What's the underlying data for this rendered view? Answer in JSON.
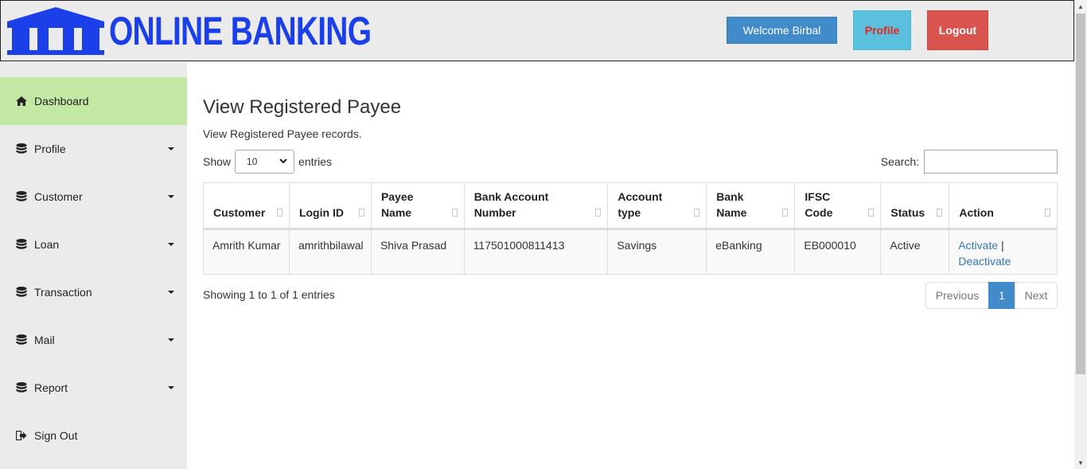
{
  "header": {
    "logo_text": "ONLINE BANKING",
    "welcome_label": "Welcome Birbal",
    "profile_label": "Profile",
    "logout_label": "Logout"
  },
  "sidebar": {
    "items": [
      {
        "label": "Dashboard",
        "icon": "home-icon",
        "active": true
      },
      {
        "label": "Profile",
        "icon": "database-icon",
        "dropdown": true
      },
      {
        "label": "Customer",
        "icon": "database-icon",
        "dropdown": true
      },
      {
        "label": "Loan",
        "icon": "database-icon",
        "dropdown": true
      },
      {
        "label": "Transaction",
        "icon": "database-icon",
        "dropdown": true
      },
      {
        "label": "Mail",
        "icon": "database-icon",
        "dropdown": true
      },
      {
        "label": "Report",
        "icon": "database-icon",
        "dropdown": true
      },
      {
        "label": "Sign Out",
        "icon": "sign-out-icon"
      }
    ]
  },
  "main": {
    "title": "View Registered Payee",
    "subtitle": "View Registered Payee records.",
    "show_label": "Show",
    "show_value": "10",
    "entries_label": "entries",
    "search_label": "Search:",
    "search_value": "",
    "columns": [
      "Customer",
      "Login ID",
      "Payee Name",
      "Bank Account Number",
      "Account type",
      "Bank Name",
      "IFSC Code",
      "Status",
      "Action"
    ],
    "rows": [
      {
        "customer": "Amrith Kumar",
        "login_id": "amrithbilawal",
        "payee_name": "Shiva Prasad",
        "account_number": "117501000811413",
        "account_type": "Savings",
        "bank_name": "eBanking",
        "ifsc": "EB000010",
        "status": "Active",
        "action_activate": "Activate",
        "action_sep": "|",
        "action_deactivate": "Deactivate"
      }
    ],
    "info": "Showing 1 to 1 of 1 entries",
    "pagination": {
      "previous": "Previous",
      "current": "1",
      "next": "Next"
    }
  },
  "colors": {
    "brand": "#1b3fe8",
    "active_nav": "#c2e8a4",
    "primary": "#428bca",
    "info": "#5bc0de",
    "danger": "#d9534f"
  }
}
